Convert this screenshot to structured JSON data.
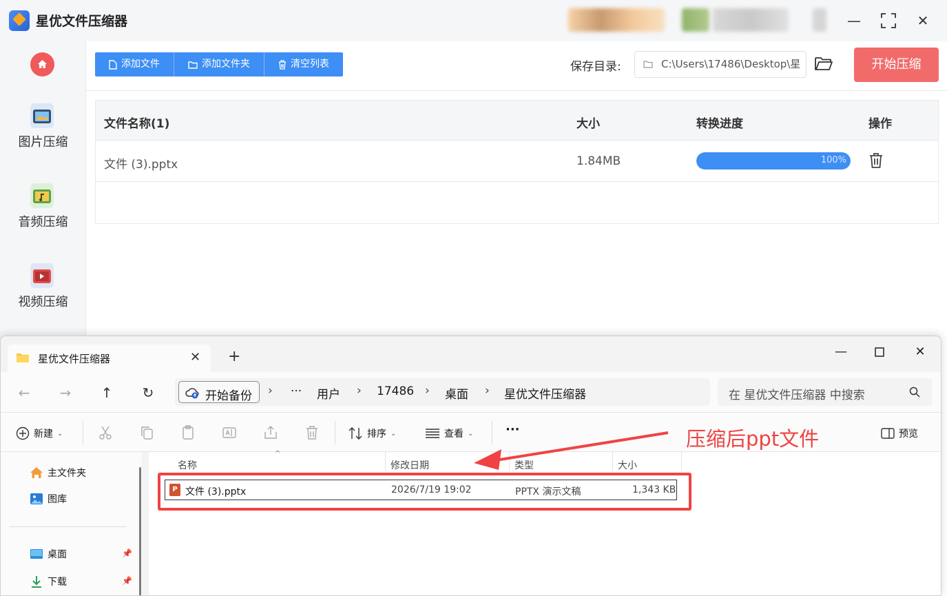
{
  "app": {
    "title": "星优文件压缩器",
    "sidebar": [
      "图片压缩",
      "音频压缩",
      "视频压缩"
    ],
    "toolbar": {
      "add_file": "添加文件",
      "add_folder": "添加文件夹",
      "clear_list": "清空列表"
    },
    "save_label": "保存目录:",
    "save_path": "C:\\Users\\17486\\Desktop\\星",
    "start_button": "开始压缩",
    "table": {
      "headers": [
        "文件名称(1)",
        "大小",
        "转换进度",
        "操作"
      ],
      "rows": [
        {
          "name": "文件 (3).pptx",
          "size": "1.84MB",
          "progress": 100,
          "progress_label": "100%"
        }
      ]
    },
    "colors": {
      "accent": "#3d8ef5",
      "start": "#f26b6b",
      "home": "#f05a5a"
    }
  },
  "explorer": {
    "tab_title": "星优文件压缩器",
    "breadcrumb": {
      "backup": "开始备份",
      "ellipsis": "···",
      "items": [
        "用户",
        "17486",
        "桌面",
        "星优文件压缩器"
      ]
    },
    "search_placeholder": "在 星优文件压缩器 中搜索",
    "commands": {
      "new": "新建",
      "sort": "排序",
      "view": "查看",
      "more": "···",
      "preview": "预览"
    },
    "nav": {
      "home": "主文件夹",
      "gallery": "图库",
      "desktop": "桌面",
      "downloads": "下载"
    },
    "columns": [
      "名称",
      "修改日期",
      "类型",
      "大小"
    ],
    "files": [
      {
        "name": "文件 (3).pptx",
        "date": "2026/7/19 19:02",
        "type": "PPTX 演示文稿",
        "size": "1,343 KB"
      }
    ]
  },
  "annotation": "压缩后ppt文件"
}
